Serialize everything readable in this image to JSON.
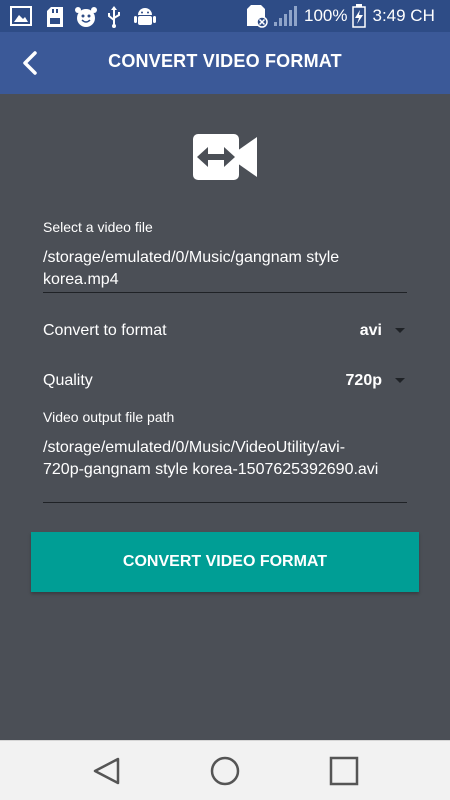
{
  "status_bar": {
    "battery_percent": "100%",
    "time": "3:49 CH",
    "left_icons": [
      "image-icon",
      "sd-card-icon",
      "face-icon",
      "usb-icon",
      "android-icon"
    ],
    "right_icons": [
      "sim-blocked-icon",
      "signal-icon",
      "battery-charging-icon"
    ]
  },
  "app_bar": {
    "title": "CONVERT VIDEO FORMAT",
    "back_icon": "back-chevron-icon"
  },
  "hero": {
    "icon": "video-convert-icon"
  },
  "form": {
    "select_label": "Select a video file",
    "select_value": "/storage/emulated/0/Music/gangnam style korea.mp4",
    "format_label": "Convert to format",
    "format_value": "avi",
    "quality_label": "Quality",
    "quality_value": "720p",
    "output_label": "Video output file path",
    "output_value": "/storage/emulated/0/Music/VideoUtility/avi-720p-gangnam style korea-1507625392690.avi"
  },
  "convert_button": {
    "label": "CONVERT VIDEO FORMAT"
  },
  "nav_bar": {
    "icons": [
      "back-triangle-icon",
      "home-circle-icon",
      "recents-square-icon"
    ]
  },
  "colors": {
    "status_bar": "#2e4c86",
    "app_bar": "#3b5998",
    "background": "#4b4f56",
    "button": "#009e95",
    "nav_bar": "#f2f2f2"
  }
}
